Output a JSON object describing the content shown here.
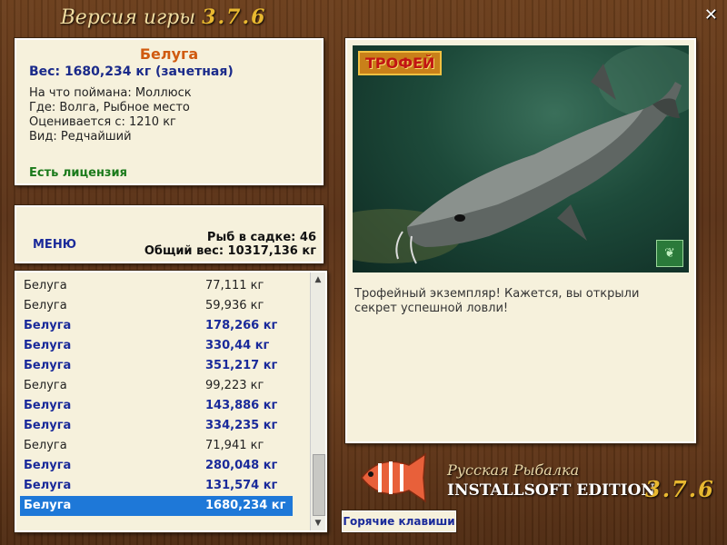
{
  "title": {
    "text": "Версия игры",
    "version": "3.7.6"
  },
  "info": {
    "fish_name": "Белуга",
    "weight_line": "Вес: 1680,234 кг (зачетная)",
    "lines": [
      "На что поймана: Моллюск",
      "Где: Волга, Рыбное место",
      "Оценивается с: 1210 кг",
      "Вид: Редчайший"
    ],
    "license": "Есть лицензия"
  },
  "stats": {
    "menu": "МЕНЮ",
    "fish_in_keepnet": "Рыб в садке: 46",
    "total_weight": "Общий вес: 10317,136 кг"
  },
  "list": [
    {
      "name": "Белуга",
      "weight": "77,111 кг",
      "bold": false
    },
    {
      "name": "Белуга",
      "weight": "59,936 кг",
      "bold": false
    },
    {
      "name": "Белуга",
      "weight": "178,266 кг",
      "bold": true
    },
    {
      "name": "Белуга",
      "weight": "330,44 кг",
      "bold": true
    },
    {
      "name": "Белуга",
      "weight": "351,217 кг",
      "bold": true
    },
    {
      "name": "Белуга",
      "weight": "99,223 кг",
      "bold": false
    },
    {
      "name": "Белуга",
      "weight": "143,886 кг",
      "bold": true
    },
    {
      "name": "Белуга",
      "weight": "334,235 кг",
      "bold": true
    },
    {
      "name": "Белуга",
      "weight": "71,941 кг",
      "bold": false
    },
    {
      "name": "Белуга",
      "weight": "280,048 кг",
      "bold": true
    },
    {
      "name": "Белуга",
      "weight": "131,574 кг",
      "bold": true
    },
    {
      "name": "Белуга",
      "weight": "1680,234 кг",
      "bold": true,
      "selected": true
    }
  ],
  "photo": {
    "trophy_label": "ТРОФЕЙ",
    "description": "Трофейный экземпляр! Кажется, вы открыли секрет успешной ловли!"
  },
  "branding": {
    "line1": "Русская Рыбалка",
    "line2": "INSTALLSOFT EDITION",
    "version": "3.7.6"
  },
  "hotkeys_label": "Горячие клавиши",
  "colors": {
    "accent": "#1a2a9a",
    "fish_name": "#d05a10",
    "license": "#1b7a1b",
    "selected": "#1e78d8"
  }
}
